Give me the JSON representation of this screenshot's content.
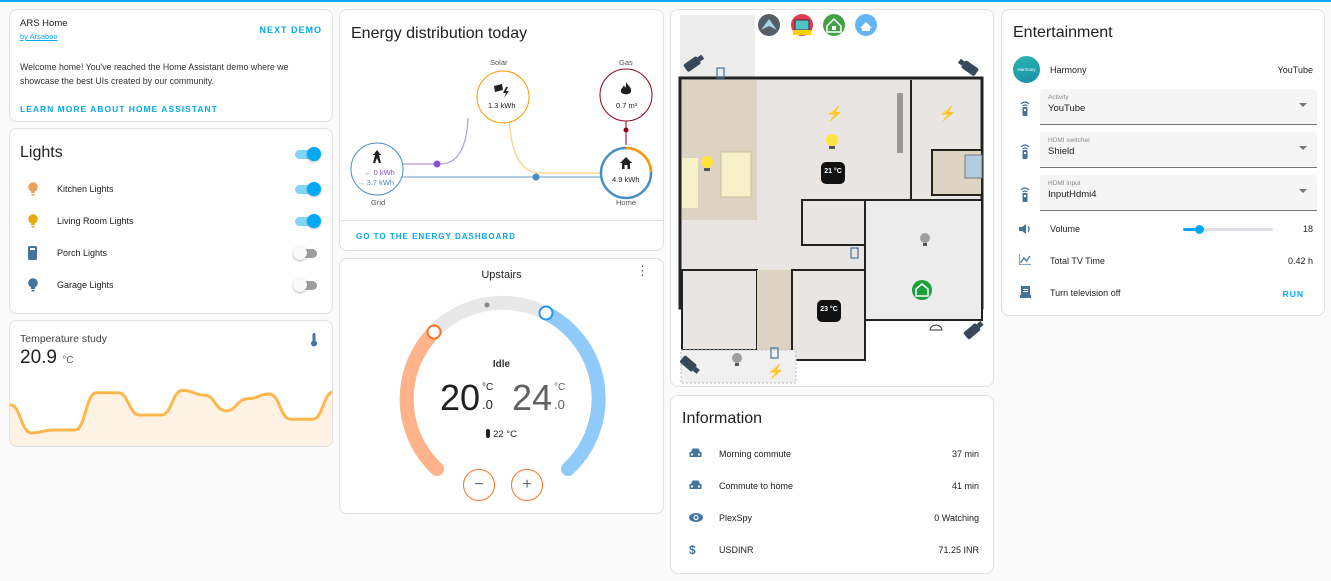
{
  "welcome": {
    "title": "ARS Home",
    "author": "by Arsaboo",
    "next_demo": "NEXT DEMO",
    "text_line1": "Welcome home! You've reached the Home Assistant demo where we",
    "text_line2": "showcase the best UIs created by our community.",
    "learn_more": "LEARN MORE ABOUT HOME ASSISTANT"
  },
  "lights": {
    "title": "Lights",
    "master_on": true,
    "items": [
      {
        "name": "Kitchen Lights",
        "on": true,
        "icon": "lightbulb-icon",
        "color": "#e8a35a"
      },
      {
        "name": "Living Room Lights",
        "on": true,
        "icon": "lightbulb-icon",
        "color": "#e6a817"
      },
      {
        "name": "Porch Lights",
        "on": false,
        "icon": "lamp-switch-icon",
        "color": "#44739e"
      },
      {
        "name": "Garage Lights",
        "on": false,
        "icon": "lightbulb-icon",
        "color": "#44739e"
      }
    ]
  },
  "temperature": {
    "title": "Temperature study",
    "value": "20.9",
    "unit": "°C",
    "icon": "thermometer-icon",
    "history": [
      0.62,
      0.15,
      0.2,
      0.2,
      0.82,
      0.82,
      0.45,
      0.45,
      0.86,
      0.78,
      0.52,
      0.72,
      0.8,
      0.38,
      0.38,
      0.84
    ],
    "line_color": "#ffb74d"
  },
  "energy": {
    "title": "Energy distribution today",
    "solar": {
      "label": "Solar",
      "value": "1.3 kWh",
      "color": "#ff9800"
    },
    "gas": {
      "label": "Gas",
      "value": "0.7 m³",
      "color": "#8e021b"
    },
    "grid": {
      "label": "Grid",
      "in": "← 0 kWh",
      "out": "→ 3.7 kWh",
      "color": "#488fc2",
      "return_color": "#8353d1"
    },
    "home": {
      "label": "Home",
      "value": "4.9 kWh"
    },
    "dashboard_link": "GO TO THE ENERGY DASHBOARD"
  },
  "thermostat": {
    "title": "Upstairs",
    "state": "Idle",
    "low": "20",
    "low_dec": ".0",
    "high": "24",
    "high_dec": ".0",
    "unit": "°C",
    "current": "22 °C",
    "minus": "−",
    "plus": "+"
  },
  "floorplan": {
    "top_icons": [
      "ars-logo-icon",
      "tv-icon",
      "home-lock-icon",
      "home-wifi-icon"
    ],
    "thermostat1": "21 °C",
    "thermostat2": "23 °C"
  },
  "information": {
    "title": "Information",
    "items": [
      {
        "icon": "car-icon",
        "name": "Morning commute",
        "value": "37 min"
      },
      {
        "icon": "car-icon",
        "name": "Commute to home",
        "value": "41 min"
      },
      {
        "icon": "eye-icon",
        "name": "PlexSpy",
        "value": "0 Watching"
      },
      {
        "icon": "currency-usd-icon",
        "name": "USDINR",
        "value": "71.25 INR"
      }
    ]
  },
  "entertainment": {
    "title": "Entertainment",
    "harmony": {
      "name": "Harmony",
      "logo_text": "Harmony",
      "state": "YouTube"
    },
    "selects": [
      {
        "label": "Activity",
        "value": "YouTube"
      },
      {
        "label": "HDMI switcher",
        "value": "Shield"
      },
      {
        "label": "HDMI input",
        "value": "InputHdmi4"
      }
    ],
    "volume": {
      "label": "Volume",
      "value": "18",
      "fraction": 0.18
    },
    "tv_time": {
      "label": "Total TV Time",
      "value": "0.42 h"
    },
    "tv_off": {
      "label": "Turn television off",
      "action": "RUN"
    }
  }
}
